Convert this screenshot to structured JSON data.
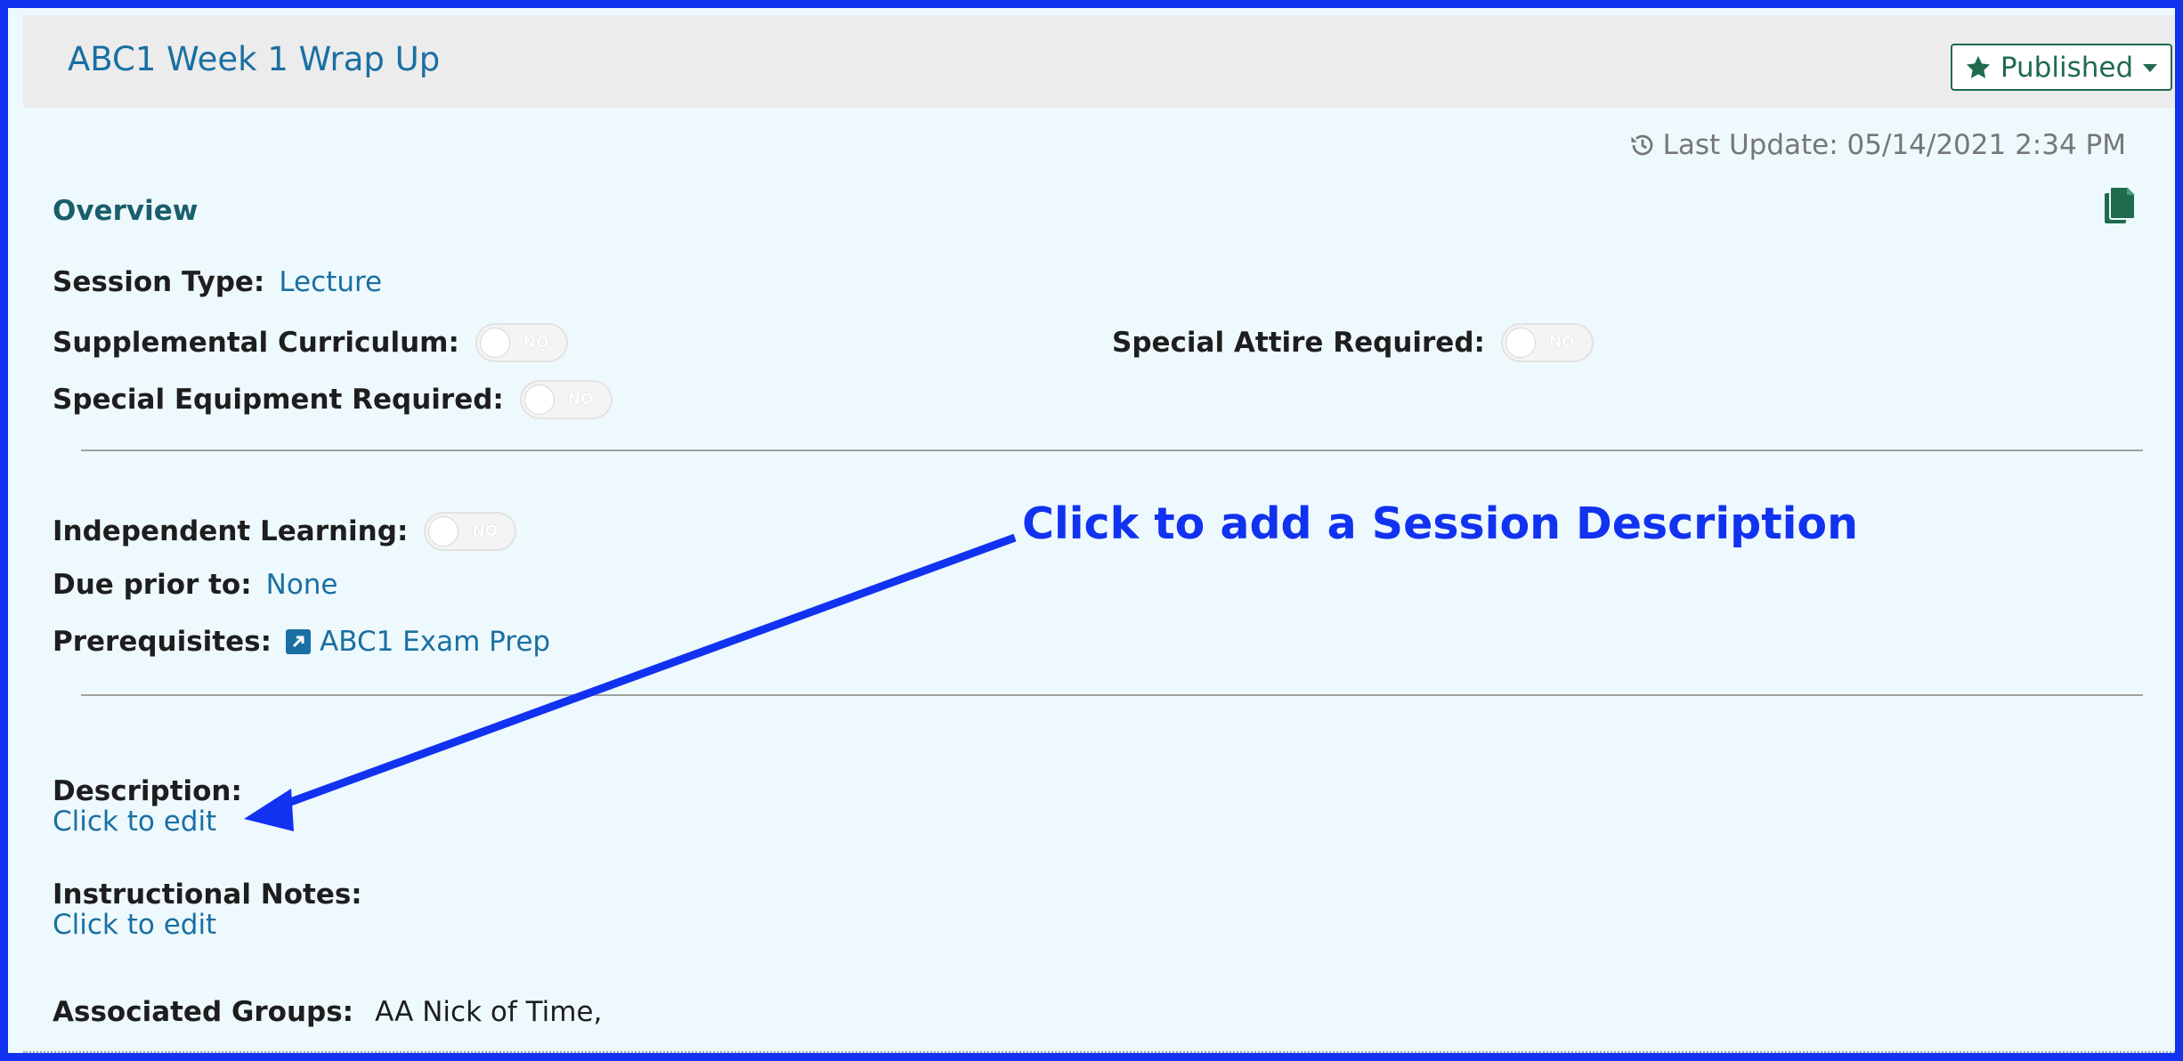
{
  "header": {
    "title": "ABC1 Week 1 Wrap Up",
    "status_button": {
      "label": "Published",
      "icon": "star-icon",
      "caret": "caret-down-icon"
    }
  },
  "meta": {
    "last_update": "Last Update: 05/14/2021 2:34 PM",
    "icon": "history-icon"
  },
  "overview": {
    "title": "Overview",
    "copy_icon": "copy-icon",
    "session_type": {
      "label": "Session Type:",
      "value": "Lecture"
    },
    "supplemental_curriculum": {
      "label": "Supplemental Curriculum:",
      "toggle": "NO"
    },
    "special_attire": {
      "label": "Special Attire Required:",
      "toggle": "NO"
    },
    "special_equipment": {
      "label": "Special Equipment Required:",
      "toggle": "NO"
    },
    "independent_learning": {
      "label": "Independent Learning:",
      "toggle": "NO"
    },
    "due_prior_to": {
      "label": "Due prior to:",
      "value": "None"
    },
    "prerequisites": {
      "label": "Prerequisites:",
      "value": "ABC1 Exam Prep",
      "icon": "external-link-icon"
    },
    "description": {
      "label": "Description:",
      "link": "Click to edit"
    },
    "instructional_notes": {
      "label": "Instructional Notes:",
      "link": "Click to edit"
    },
    "associated_groups": {
      "label": "Associated Groups:",
      "value": "AA Nick of Time,"
    }
  },
  "annotation": {
    "text": "Click to add a Session Description"
  },
  "colors": {
    "accent": "#1a6fa3",
    "published": "#1f6b4e",
    "annotation": "#1132f0",
    "panel": "#eef9fd"
  }
}
